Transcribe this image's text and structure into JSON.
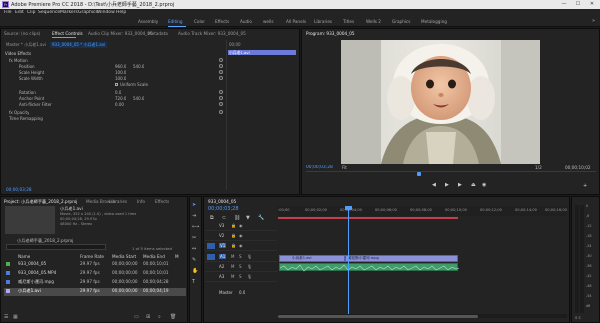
{
  "window": {
    "title": "Adobe Premiere Pro CC 2018 - D:\\Test\\小兵老師手藝_2018_2.prproj",
    "app_icon": "Pr",
    "minimize": "—",
    "maximize": "☐",
    "close": "✕"
  },
  "menu": [
    "File",
    "Edit",
    "Clip",
    "Sequence",
    "Markers",
    "Graphics",
    "Window",
    "Help"
  ],
  "workspaces": {
    "tabs": [
      "Assembly",
      "Editing",
      "Color",
      "Effects",
      "Audio",
      "wells",
      "All Panels",
      "Libraries",
      "Titles",
      "Wells 2",
      "Graphics",
      "Metalogging"
    ],
    "active_index": 1
  },
  "source_panel": {
    "tabs": [
      "Source: (no clips)",
      "Effect Controls",
      "Audio Clip Mixer: 933_0004_05",
      "Metadata",
      "Audio Track Mixer: 933_0004_05"
    ],
    "master_label": "Master * 小兵老1.avi",
    "clip_label": "933_0004_05 * 小兵老1.avi",
    "ruler_time": "00;00",
    "mini_clip": "小兵老1.avi",
    "section_video": "Video Effects",
    "effects": [
      {
        "name": "fx  Motion",
        "value": "",
        "value2": ""
      },
      {
        "name": "Position",
        "value": "960.0",
        "value2": "540.0"
      },
      {
        "name": "Scale Height",
        "value": "100.0",
        "value2": ""
      },
      {
        "name": "Scale Width",
        "value": "100.0",
        "value2": ""
      },
      {
        "name": "",
        "value": "Uniform Scale",
        "value2": ""
      },
      {
        "name": "Rotation",
        "value": "0.0",
        "value2": ""
      },
      {
        "name": "Anchor Point",
        "value": "720.0",
        "value2": "540.0"
      },
      {
        "name": "Anti-flicker Filter",
        "value": "0.00",
        "value2": ""
      },
      {
        "name": "fx  Opacity",
        "value": "",
        "value2": ""
      },
      {
        "name": "Time Remapping",
        "value": "",
        "value2": ""
      }
    ],
    "timecode": "00;00;03;28"
  },
  "program_panel": {
    "title": "Program: 933_0004_05",
    "timecode": "00;00;03;28",
    "fit": "Fit",
    "resolution": "1/2",
    "duration": "00;00;10;02"
  },
  "project_panel": {
    "tabs": [
      "Project: 小兵老師手藝_2018_2.prproj",
      "Media Browser",
      "Libraries",
      "Info",
      "Effects"
    ],
    "preview_name": "小兵老1.avi",
    "preview_meta": [
      "Movie, 352 x 240 (1.0) , video used 1 time",
      "00;00;04;28, 29.97p",
      "48000 Hz - Stereo"
    ],
    "bin_path": "小兵老師手藝_2018_2.prproj",
    "selection": "1 of 5 items selected",
    "columns": [
      "Name",
      "Frame Rate",
      "Media Start",
      "Media End",
      "M"
    ],
    "items": [
      {
        "name": "933_0004_05",
        "rate": "29.97 fps",
        "start": "00;00;00;00",
        "end": "00;00;10;01",
        "color": "#4caf50"
      },
      {
        "name": "933_0004_05.MP4",
        "rate": "29.97 fps",
        "start": "00;00;00;00",
        "end": "00;00;10;01",
        "color": "#4f7bd8"
      },
      {
        "name": "威尼斯小運河.mpg",
        "rate": "29.97 fps",
        "start": "00;00;00;00",
        "end": "00;00;04;28",
        "color": "#4f7bd8"
      },
      {
        "name": "小兵老1.avi",
        "rate": "29.97 fps",
        "start": "00;00;00;00",
        "end": "00;00;04;19",
        "color": "#b7a3f0"
      }
    ]
  },
  "timeline": {
    "tab": "933_0004_05",
    "timecode": "00;00;03;28",
    "ruler": [
      ":00;00",
      "00;00;02;00",
      "00;00;04;00",
      "00;00;06;00",
      "00;00;08;00",
      "00;00;10;00",
      "00;00;12;00",
      "00;00;14;00",
      "00;00;16;00"
    ],
    "tracks": [
      "V3",
      "V2",
      "V1",
      "A1",
      "A2",
      "A3"
    ],
    "master": "Master",
    "master_value": "0.0",
    "clips": {
      "v1_a": "小兵老1.avi",
      "v1_b": "威尼斯小運河.mpg"
    }
  },
  "meter": {
    "labels": [
      "0",
      "-6",
      "-12",
      "-18",
      "-24",
      "-30",
      "-36",
      "-42",
      "-48",
      "-54",
      "dB"
    ],
    "footer": "S  S"
  }
}
